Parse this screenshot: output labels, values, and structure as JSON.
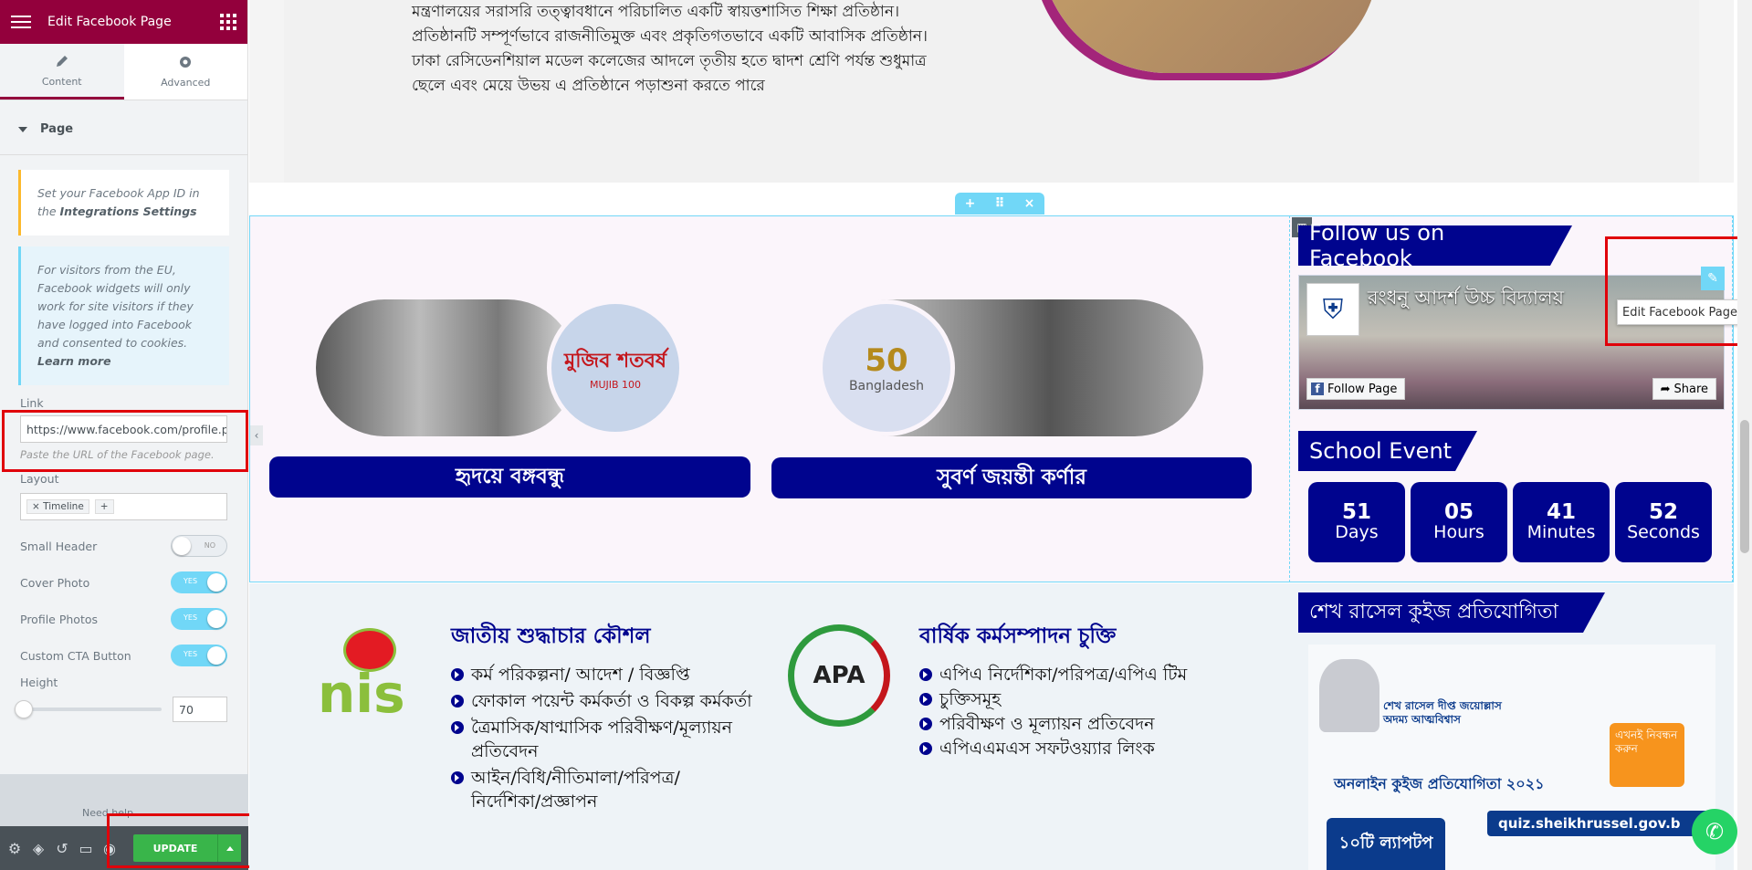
{
  "panel": {
    "title": "Edit Facebook Page",
    "tabs": [
      {
        "label": "Content"
      },
      {
        "label": "Advanced"
      }
    ],
    "section": "Page",
    "note1_pre": "Set your Facebook App ID in the",
    "note1_link": "Integrations Settings",
    "note2_text": "For visitors from the EU, Facebook widgets will only work for site visitors if they have logged into Facebook and consented to cookies.",
    "note2_link": "Learn more",
    "link_label": "Link",
    "link_value": "https://www.facebook.com/profile.ph",
    "link_hint": "Paste the URL of the Facebook page.",
    "layout_label": "Layout",
    "layout_tag": "Timeline",
    "toggles": [
      {
        "label": "Small Header",
        "state": "NO"
      },
      {
        "label": "Cover Photo",
        "state": "YES"
      },
      {
        "label": "Profile Photos",
        "state": "YES"
      },
      {
        "label": "Custom CTA Button",
        "state": "YES"
      }
    ],
    "height_label": "Height",
    "height_value": "70",
    "height_fraction": 0.0,
    "need_help": "Need help",
    "update_label": "UPDATE"
  },
  "page": {
    "intro_lines": [
      "মন্ত্রণালয়ের সরাসরি তত্ত্বাবধানে পরিচালিত একটি স্বায়ত্তশাসিত শিক্ষা প্রতিষ্ঠান।",
      "প্রতিষ্ঠানটি সম্পূর্ণভাবে রাজনীতিমুক্ত এবং প্রকৃতিগতভাবে একটি আবাসিক প্রতিষ্ঠান।",
      "ঢাকা রেসিডেনশিয়াল মডেল কলেজের আদলে তৃতীয় হতে দ্বাদশ শ্রেণি পর্যন্ত শুধুমাত্র",
      "ছেলে এবং মেয়ে উভয় এ প্রতিষ্ঠানে পড়াশুনা করতে পারে"
    ],
    "banner1_label": "হৃদয়ে বঙ্গবন্ধু",
    "banner1_logo": "মুজিব শতবর্ষ",
    "banner1_logo_sub": "MUJIB 100",
    "banner2_label": "সুবর্ণ জয়ন্তী কর্ণার",
    "banner2_logo": "Bangladesh",
    "banner2_logo_num": "50",
    "fb_title": "Follow us on Facebook",
    "fb_page_name": "রংধনু আদর্শ উচ্চ বিদ্যালয়",
    "fb_follow": "Follow Page",
    "fb_share": "Share",
    "edit_tooltip": "Edit Facebook Page",
    "event_title": "School Event",
    "countdown": [
      {
        "num": "51",
        "unit": "Days"
      },
      {
        "num": "05",
        "unit": "Hours"
      },
      {
        "num": "41",
        "unit": "Minutes"
      },
      {
        "num": "52",
        "unit": "Seconds"
      }
    ],
    "nis_title": "জাতীয় শুদ্ধাচার কৌশল",
    "nis_logo": "nis",
    "nis_items": [
      "কর্ম পরিকল্পনা/ আদেশ / বিজ্ঞপ্তি",
      "ফোকাল পয়েন্ট কর্মকর্তা ও বিকল্প কর্মকর্তা",
      "ত্রৈমাসিক/ষাণ্মাসিক পরিবীক্ষণ/মূল্যায়ন প্রতিবেদন",
      "আইন/বিধি/নীতিমালা/পরিপত্র/ নির্দেশিকা/প্রজ্ঞাপন"
    ],
    "apa_title": "বার্ষিক কর্মসম্পাদন চুক্তি",
    "apa_logo": "APA",
    "apa_items": [
      "এপিএ নির্দেশিকা/পরিপত্র/এপিএ টিম",
      "চুক্তিসমূহ",
      "পরিবীক্ষণ ও মূল্যায়ন প্রতিবেদন",
      "এপিএএমএস সফটওয়্যার লিংক"
    ],
    "quiz_title": "শেখ রাসেল কুইজ প্রতিযোগিতা",
    "quiz_poster_title": "শেখ রাসেল দীপ্ত জয়োল্লাস অদম্য আত্মবিশ্বাস",
    "quiz_online": "অনলাইন কুইজ প্রতিযোগিতা ২০২১",
    "quiz_register": "এখনই নিবন্ধন করুন",
    "quiz_prize": "১০টি ল্যাপটপ",
    "quiz_url": "quiz.sheikhrussel.gov.b"
  },
  "colors": {
    "brand": "#93003c",
    "navy": "#00048e",
    "green": "#39b54a",
    "cyan": "#71d7f7"
  }
}
